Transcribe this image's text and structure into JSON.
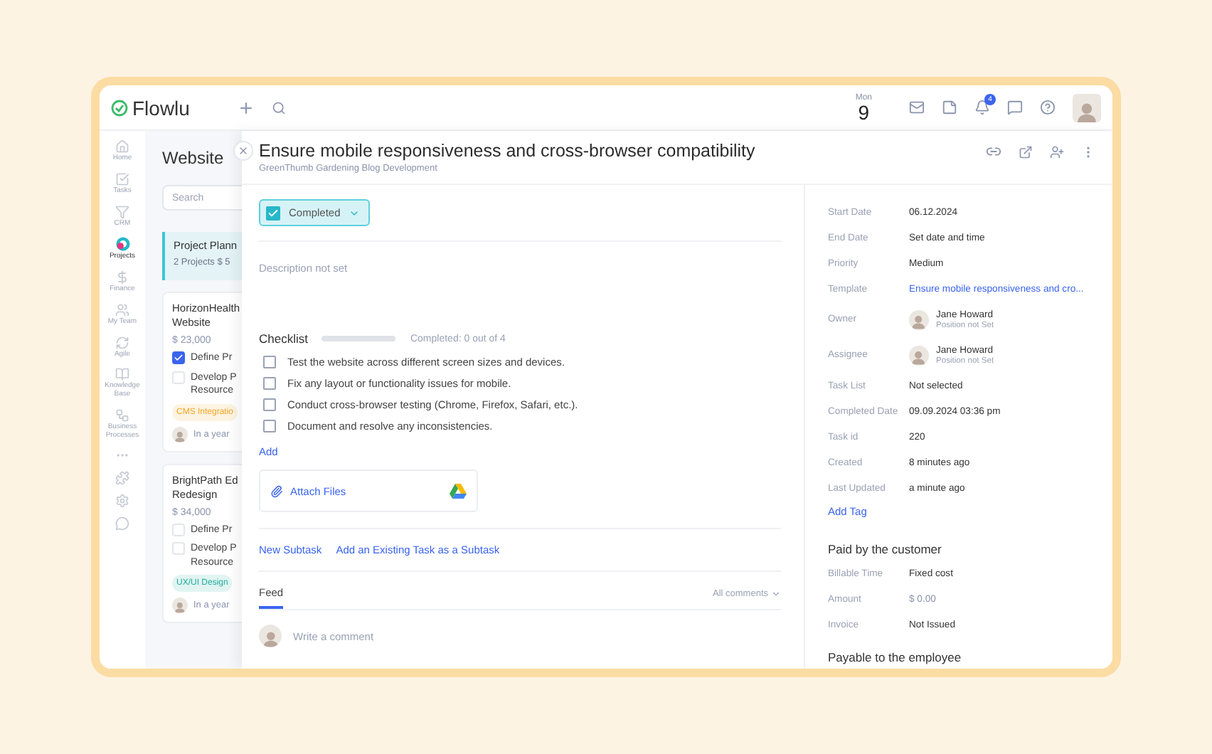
{
  "app": {
    "logo": "Flowlu",
    "day_name": "Mon",
    "day_number": "9",
    "notification_count": "4"
  },
  "nav": [
    {
      "label": "Home",
      "selected": false
    },
    {
      "label": "Tasks",
      "selected": false
    },
    {
      "label": "CRM",
      "selected": false
    },
    {
      "label": "Projects",
      "selected": true
    },
    {
      "label": "Finance",
      "selected": false
    },
    {
      "label": "My Team",
      "selected": false
    },
    {
      "label": "Agile",
      "selected": false
    },
    {
      "label": "Knowledge Base",
      "selected": false
    },
    {
      "label": "Business Processes",
      "selected": false
    }
  ],
  "project_list": {
    "title": "Website",
    "search_placeholder": "Search",
    "group": {
      "title": "Project Plann",
      "summary": "2 Projects  $ 5"
    },
    "cards": [
      {
        "title": [
          "HorizonHealth",
          "Website"
        ],
        "amount": "$ 23,000",
        "tasks": [
          {
            "lines": [
              "Define Pr"
            ],
            "checked": true
          },
          {
            "lines": [
              "Develop P",
              "Resource"
            ],
            "checked": false
          }
        ],
        "tag": {
          "label": "CMS Integratio",
          "color": "#f2a623"
        },
        "due": "In a year"
      },
      {
        "title": [
          "BrightPath Ed",
          "Redesign"
        ],
        "amount": "$ 34,000",
        "tasks": [
          {
            "lines": [
              "Define Pr"
            ],
            "checked": false
          },
          {
            "lines": [
              "Develop P",
              "Resource"
            ],
            "checked": false
          }
        ],
        "tag": {
          "label": "UX/UI Design",
          "color": "#1fae9b"
        },
        "due": "In a year"
      }
    ]
  },
  "task": {
    "title": "Ensure mobile responsiveness and cross-browser compatibility",
    "subtitle": "GreenThumb Gardening Blog Development",
    "status": {
      "label": "Completed",
      "checked": true
    },
    "description_placeholder": "Description not set",
    "checklist": {
      "title": "Checklist",
      "level": 0,
      "progress_text": "Completed: 0 out of 4",
      "add_link": "Add",
      "items": [
        {
          "text": "Test the website across different screen sizes and devices.",
          "checked": false
        },
        {
          "text": "Fix any layout or functionality issues for mobile.",
          "checked": false
        },
        {
          "text": "Conduct cross-browser testing (Chrome, Firefox, Safari, etc.).",
          "checked": false
        },
        {
          "text": "Document and resolve any inconsistencies.",
          "checked": false
        }
      ]
    },
    "attach_label": "Attach Files",
    "subtask_links": [
      "New Subtask",
      "Add an Existing Task as a Subtask"
    ],
    "feed": {
      "tabs": [
        {
          "label": "Feed",
          "selected": true
        }
      ],
      "filter": "All comments",
      "comment_placeholder": "Write a comment"
    }
  },
  "details": {
    "fields": [
      {
        "kind": "text",
        "label": "Start Date",
        "value": "06.12.2024"
      },
      {
        "kind": "text",
        "label": "End Date",
        "value": "Set date and time"
      },
      {
        "kind": "text",
        "label": "Priority",
        "value": "Medium"
      },
      {
        "kind": "link",
        "label": "Template",
        "value": "Ensure mobile responsiveness and cro..."
      },
      {
        "kind": "person",
        "label": "Owner",
        "value": "Jane Howard",
        "note": "Position not Set"
      },
      {
        "kind": "person",
        "label": "Assignee",
        "value": "Jane Howard",
        "note": "Position not Set"
      },
      {
        "kind": "text",
        "label": "Task List",
        "value": "Not selected"
      },
      {
        "kind": "text",
        "label": "Completed Date",
        "value": "09.09.2024 03:36 pm"
      },
      {
        "kind": "text",
        "label": "Task id",
        "value": "220"
      },
      {
        "kind": "text",
        "label": "Created",
        "value": "8 minutes ago"
      },
      {
        "kind": "text",
        "label": "Last Updated",
        "value": "a minute ago"
      }
    ],
    "add_tag": "Add Tag",
    "sections": [
      {
        "title": "Paid by the customer",
        "fields": [
          {
            "kind": "text",
            "label": "Billable Time",
            "value": "Fixed cost"
          },
          {
            "kind": "muted",
            "label": "Amount",
            "value": "$ 0.00"
          },
          {
            "kind": "text",
            "label": "Invoice",
            "value": "Not Issued"
          }
        ]
      },
      {
        "title": "Payable to the employee"
      }
    ]
  }
}
